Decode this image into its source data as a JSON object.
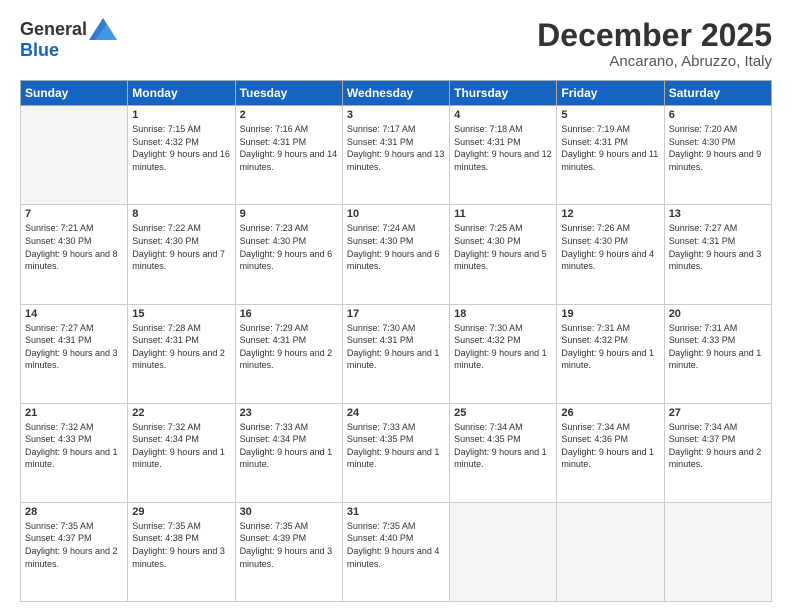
{
  "header": {
    "logo_general": "General",
    "logo_blue": "Blue",
    "month": "December 2025",
    "location": "Ancarano, Abruzzo, Italy"
  },
  "days_of_week": [
    "Sunday",
    "Monday",
    "Tuesday",
    "Wednesday",
    "Thursday",
    "Friday",
    "Saturday"
  ],
  "weeks": [
    [
      {
        "day": "",
        "sunrise": "",
        "sunset": "",
        "daylight": "",
        "empty": true
      },
      {
        "day": "1",
        "sunrise": "Sunrise: 7:15 AM",
        "sunset": "Sunset: 4:32 PM",
        "daylight": "Daylight: 9 hours and 16 minutes."
      },
      {
        "day": "2",
        "sunrise": "Sunrise: 7:16 AM",
        "sunset": "Sunset: 4:31 PM",
        "daylight": "Daylight: 9 hours and 14 minutes."
      },
      {
        "day": "3",
        "sunrise": "Sunrise: 7:17 AM",
        "sunset": "Sunset: 4:31 PM",
        "daylight": "Daylight: 9 hours and 13 minutes."
      },
      {
        "day": "4",
        "sunrise": "Sunrise: 7:18 AM",
        "sunset": "Sunset: 4:31 PM",
        "daylight": "Daylight: 9 hours and 12 minutes."
      },
      {
        "day": "5",
        "sunrise": "Sunrise: 7:19 AM",
        "sunset": "Sunset: 4:31 PM",
        "daylight": "Daylight: 9 hours and 11 minutes."
      },
      {
        "day": "6",
        "sunrise": "Sunrise: 7:20 AM",
        "sunset": "Sunset: 4:30 PM",
        "daylight": "Daylight: 9 hours and 9 minutes."
      }
    ],
    [
      {
        "day": "7",
        "sunrise": "Sunrise: 7:21 AM",
        "sunset": "Sunset: 4:30 PM",
        "daylight": "Daylight: 9 hours and 8 minutes."
      },
      {
        "day": "8",
        "sunrise": "Sunrise: 7:22 AM",
        "sunset": "Sunset: 4:30 PM",
        "daylight": "Daylight: 9 hours and 7 minutes."
      },
      {
        "day": "9",
        "sunrise": "Sunrise: 7:23 AM",
        "sunset": "Sunset: 4:30 PM",
        "daylight": "Daylight: 9 hours and 6 minutes."
      },
      {
        "day": "10",
        "sunrise": "Sunrise: 7:24 AM",
        "sunset": "Sunset: 4:30 PM",
        "daylight": "Daylight: 9 hours and 6 minutes."
      },
      {
        "day": "11",
        "sunrise": "Sunrise: 7:25 AM",
        "sunset": "Sunset: 4:30 PM",
        "daylight": "Daylight: 9 hours and 5 minutes."
      },
      {
        "day": "12",
        "sunrise": "Sunrise: 7:26 AM",
        "sunset": "Sunset: 4:30 PM",
        "daylight": "Daylight: 9 hours and 4 minutes."
      },
      {
        "day": "13",
        "sunrise": "Sunrise: 7:27 AM",
        "sunset": "Sunset: 4:31 PM",
        "daylight": "Daylight: 9 hours and 3 minutes."
      }
    ],
    [
      {
        "day": "14",
        "sunrise": "Sunrise: 7:27 AM",
        "sunset": "Sunset: 4:31 PM",
        "daylight": "Daylight: 9 hours and 3 minutes."
      },
      {
        "day": "15",
        "sunrise": "Sunrise: 7:28 AM",
        "sunset": "Sunset: 4:31 PM",
        "daylight": "Daylight: 9 hours and 2 minutes."
      },
      {
        "day": "16",
        "sunrise": "Sunrise: 7:29 AM",
        "sunset": "Sunset: 4:31 PM",
        "daylight": "Daylight: 9 hours and 2 minutes."
      },
      {
        "day": "17",
        "sunrise": "Sunrise: 7:30 AM",
        "sunset": "Sunset: 4:31 PM",
        "daylight": "Daylight: 9 hours and 1 minute."
      },
      {
        "day": "18",
        "sunrise": "Sunrise: 7:30 AM",
        "sunset": "Sunset: 4:32 PM",
        "daylight": "Daylight: 9 hours and 1 minute."
      },
      {
        "day": "19",
        "sunrise": "Sunrise: 7:31 AM",
        "sunset": "Sunset: 4:32 PM",
        "daylight": "Daylight: 9 hours and 1 minute."
      },
      {
        "day": "20",
        "sunrise": "Sunrise: 7:31 AM",
        "sunset": "Sunset: 4:33 PM",
        "daylight": "Daylight: 9 hours and 1 minute."
      }
    ],
    [
      {
        "day": "21",
        "sunrise": "Sunrise: 7:32 AM",
        "sunset": "Sunset: 4:33 PM",
        "daylight": "Daylight: 9 hours and 1 minute."
      },
      {
        "day": "22",
        "sunrise": "Sunrise: 7:32 AM",
        "sunset": "Sunset: 4:34 PM",
        "daylight": "Daylight: 9 hours and 1 minute."
      },
      {
        "day": "23",
        "sunrise": "Sunrise: 7:33 AM",
        "sunset": "Sunset: 4:34 PM",
        "daylight": "Daylight: 9 hours and 1 minute."
      },
      {
        "day": "24",
        "sunrise": "Sunrise: 7:33 AM",
        "sunset": "Sunset: 4:35 PM",
        "daylight": "Daylight: 9 hours and 1 minute."
      },
      {
        "day": "25",
        "sunrise": "Sunrise: 7:34 AM",
        "sunset": "Sunset: 4:35 PM",
        "daylight": "Daylight: 9 hours and 1 minute."
      },
      {
        "day": "26",
        "sunrise": "Sunrise: 7:34 AM",
        "sunset": "Sunset: 4:36 PM",
        "daylight": "Daylight: 9 hours and 1 minute."
      },
      {
        "day": "27",
        "sunrise": "Sunrise: 7:34 AM",
        "sunset": "Sunset: 4:37 PM",
        "daylight": "Daylight: 9 hours and 2 minutes."
      }
    ],
    [
      {
        "day": "28",
        "sunrise": "Sunrise: 7:35 AM",
        "sunset": "Sunset: 4:37 PM",
        "daylight": "Daylight: 9 hours and 2 minutes."
      },
      {
        "day": "29",
        "sunrise": "Sunrise: 7:35 AM",
        "sunset": "Sunset: 4:38 PM",
        "daylight": "Daylight: 9 hours and 3 minutes."
      },
      {
        "day": "30",
        "sunrise": "Sunrise: 7:35 AM",
        "sunset": "Sunset: 4:39 PM",
        "daylight": "Daylight: 9 hours and 3 minutes."
      },
      {
        "day": "31",
        "sunrise": "Sunrise: 7:35 AM",
        "sunset": "Sunset: 4:40 PM",
        "daylight": "Daylight: 9 hours and 4 minutes."
      },
      {
        "day": "",
        "sunrise": "",
        "sunset": "",
        "daylight": "",
        "empty": true
      },
      {
        "day": "",
        "sunrise": "",
        "sunset": "",
        "daylight": "",
        "empty": true
      },
      {
        "day": "",
        "sunrise": "",
        "sunset": "",
        "daylight": "",
        "empty": true
      }
    ]
  ]
}
